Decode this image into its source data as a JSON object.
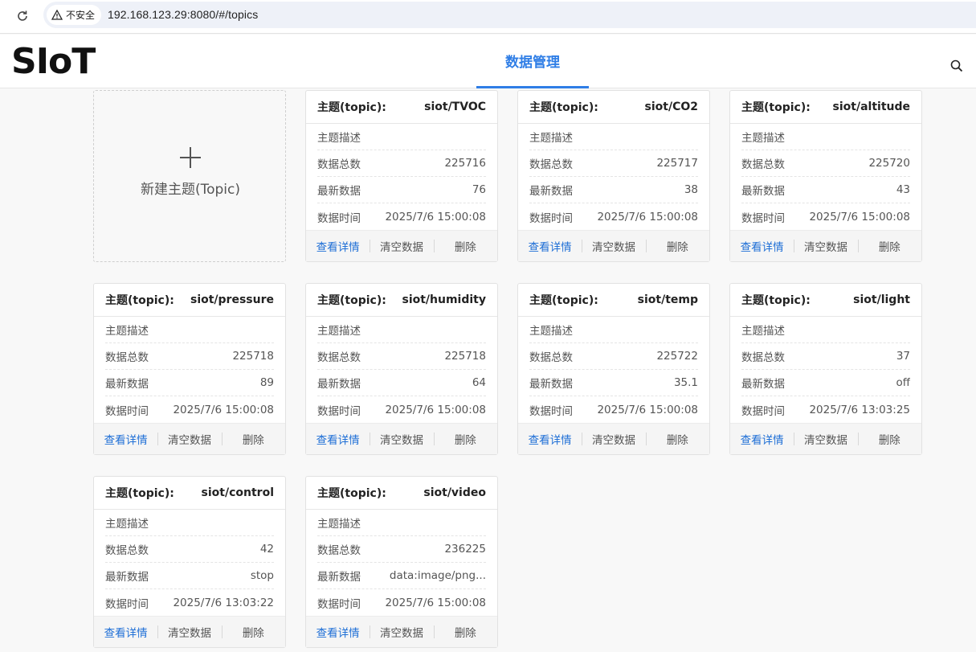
{
  "browser": {
    "security_label": "不安全",
    "url": "192.168.123.29:8080/#/topics"
  },
  "header": {
    "logo": "SIoT",
    "nav_tab": "数据管理"
  },
  "new_topic_label": "新建主题(Topic)",
  "labels": {
    "topic_prefix": "主题(topic):",
    "description": "主题描述",
    "total": "数据总数",
    "latest": "最新数据",
    "time": "数据时间",
    "view": "查看详情",
    "clear": "清空数据",
    "delete": "删除"
  },
  "topics": [
    {
      "name": "siot/TVOC",
      "description": "",
      "total": "225716",
      "latest": "76",
      "time": "2025/7/6 15:00:08"
    },
    {
      "name": "siot/CO2",
      "description": "",
      "total": "225717",
      "latest": "38",
      "time": "2025/7/6 15:00:08"
    },
    {
      "name": "siot/altitude",
      "description": "",
      "total": "225720",
      "latest": "43",
      "time": "2025/7/6 15:00:08"
    },
    {
      "name": "siot/pressure",
      "description": "",
      "total": "225718",
      "latest": "89",
      "time": "2025/7/6 15:00:08"
    },
    {
      "name": "siot/humidity",
      "description": "",
      "total": "225718",
      "latest": "64",
      "time": "2025/7/6 15:00:08"
    },
    {
      "name": "siot/temp",
      "description": "",
      "total": "225722",
      "latest": "35.1",
      "time": "2025/7/6 15:00:08"
    },
    {
      "name": "siot/light",
      "description": "",
      "total": "37",
      "latest": "off",
      "time": "2025/7/6 13:03:25"
    },
    {
      "name": "siot/control",
      "description": "",
      "total": "42",
      "latest": "stop",
      "time": "2025/7/6 13:03:22"
    },
    {
      "name": "siot/video",
      "description": "",
      "total": "236225",
      "latest": "data:image/png...",
      "time": "2025/7/6 15:00:08"
    }
  ]
}
